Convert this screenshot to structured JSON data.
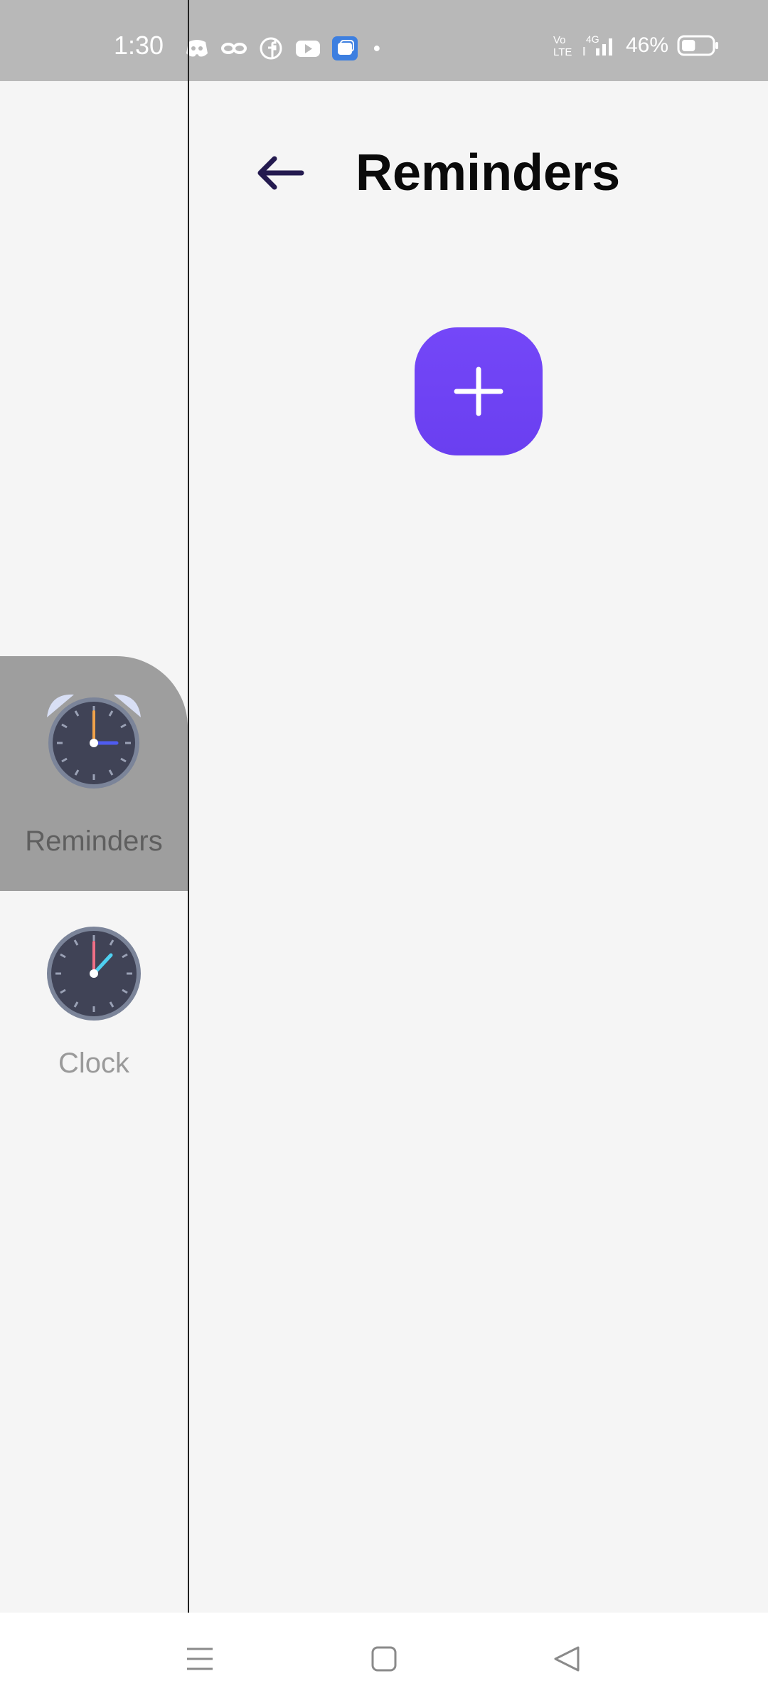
{
  "status_bar": {
    "time": "1:30",
    "battery_percent": "46%",
    "battery_level": 0.46,
    "left_icons": [
      "discord-icon",
      "infinity-icon",
      "facebook-icon",
      "youtube-icon",
      "app-icon",
      "dot-icon"
    ],
    "right_icons": [
      "volte-icon",
      "signal-4g-icon",
      "battery-icon"
    ],
    "volte_label": "Vo LTE",
    "network_label": "4G"
  },
  "sidebar": {
    "items": [
      {
        "label": "Reminders",
        "icon": "alarm-clock-icon",
        "active": true
      },
      {
        "label": "Clock",
        "icon": "clock-icon",
        "active": false
      }
    ]
  },
  "header": {
    "title": "Reminders",
    "back_icon": "back-arrow-icon"
  },
  "main": {
    "add_button_icon": "plus-icon"
  },
  "colors": {
    "accent": "#7447f8",
    "status_bar": "#b8b8b8",
    "active_nav_bg": "#9e9e9e",
    "background": "#f5f5f5"
  },
  "system_nav": {
    "icons": [
      "menu-icon",
      "home-icon",
      "back-icon"
    ]
  }
}
